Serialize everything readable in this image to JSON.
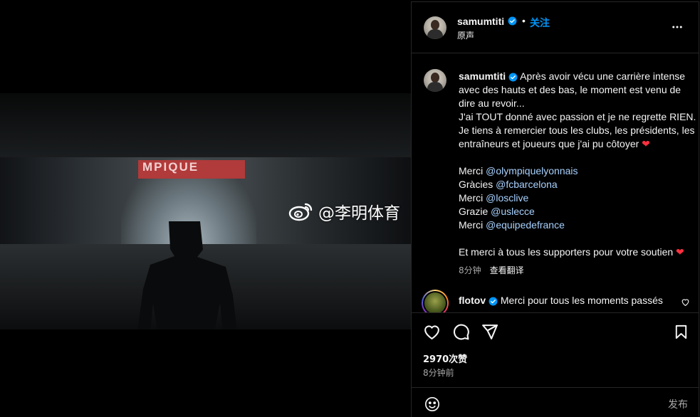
{
  "video": {
    "banner_text": "MPIQUE",
    "watermark": "@李明体育",
    "mute_icon": "speaker-muted-icon"
  },
  "header": {
    "username": "samumtiti",
    "verified": true,
    "separator": "•",
    "follow_label": "关注",
    "audio_label": "原声",
    "more_icon": "more-horizontal-icon"
  },
  "caption": {
    "username": "samumtiti",
    "lines": [
      "Après avoir vécu une carrière intense",
      "avec des hauts et des bas, le moment est venu de",
      "dire au revoir...",
      "J'ai TOUT donné avec passion et je ne regrette RIEN.",
      "Je tiens à remercier tous les clubs, les présidents, les",
      "entraîneurs et joueurs que j'ai pu côtoyer"
    ],
    "thanks": [
      {
        "word": "Merci",
        "mention": "@olympiquelyonnais"
      },
      {
        "word": "Gràcies",
        "mention": "@fcbarcelona"
      },
      {
        "word": "Merci",
        "mention": "@losclive"
      },
      {
        "word": "Grazie",
        "mention": "@uslecce"
      },
      {
        "word": "Merci",
        "mention": "@equipedefrance"
      }
    ],
    "closing": "Et merci à tous les supporters pour votre soutien",
    "heart": "❤",
    "time": "8分钟",
    "translate_label": "查看翻译"
  },
  "comment": {
    "username": "flotov",
    "text": "Merci pour tous les moments passés",
    "like_icon": "heart-outline-icon"
  },
  "actions": {
    "likes": "2970次赞",
    "posted": "8分钟前"
  },
  "comment_bar": {
    "placeholder": "",
    "post_label": "发布"
  },
  "colors": {
    "accent": "#0095f6",
    "heart": "#ff3040",
    "background": "#000000",
    "secondary_text": "#a8a8a8"
  }
}
